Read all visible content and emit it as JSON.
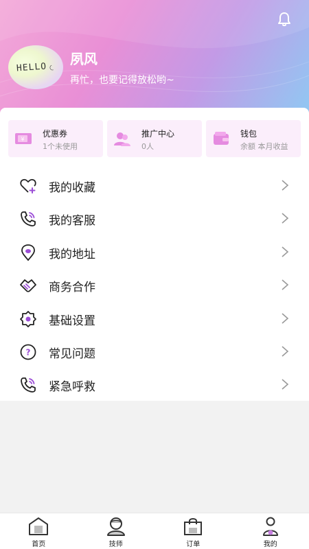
{
  "header": {
    "username": "夙风",
    "slogan": "再忙，也要记得放松哟~",
    "avatar_text": "HELLO",
    "avatar_smile": "◡"
  },
  "cards": [
    {
      "title": "优惠券",
      "sub": "1个未使用",
      "icon": "coupon-icon"
    },
    {
      "title": "推广中心",
      "sub": "0人",
      "icon": "users-icon"
    },
    {
      "title": "钱包",
      "sub": "余额 本月收益",
      "icon": "wallet-icon"
    }
  ],
  "menu": [
    {
      "label": "我的收藏",
      "icon": "heart-plus-icon"
    },
    {
      "label": "我的客服",
      "icon": "phone-wave-icon"
    },
    {
      "label": "我的地址",
      "icon": "location-pin-icon"
    },
    {
      "label": "商务合作",
      "icon": "handshake-icon"
    },
    {
      "label": "基础设置",
      "icon": "settings-gear-icon"
    },
    {
      "label": "常见问题",
      "icon": "question-icon"
    },
    {
      "label": "紧急呼救",
      "icon": "phone-wave-icon"
    }
  ],
  "tabs": [
    {
      "label": "首页",
      "icon": "home-icon"
    },
    {
      "label": "技师",
      "icon": "technician-icon"
    },
    {
      "label": "订单",
      "icon": "order-bag-icon"
    },
    {
      "label": "我的",
      "icon": "profile-icon"
    }
  ],
  "colors": {
    "accent": "#9b4dd6",
    "header_pink": "#e98fd6",
    "header_blue": "#8fc9f3",
    "card_bg": "#fbeefb"
  }
}
